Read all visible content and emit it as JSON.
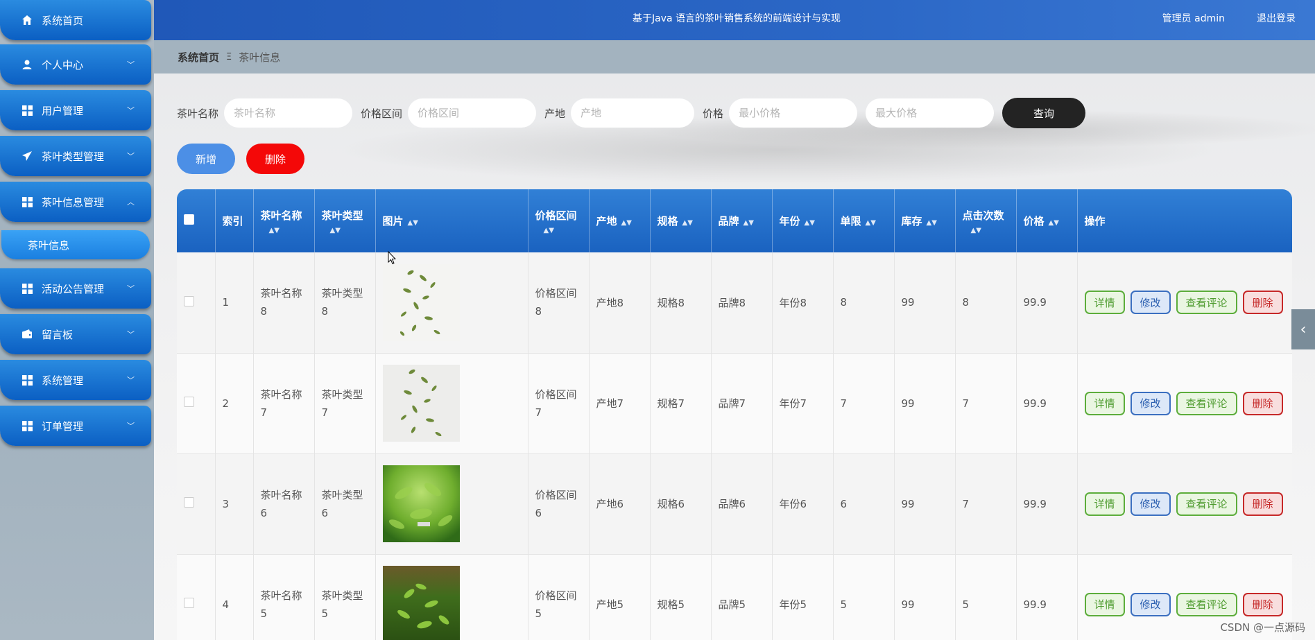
{
  "header": {
    "title": "基于Java 语言的茶叶销售系统的前端设计与实现",
    "user_label": "管理员 admin",
    "logout": "退出登录"
  },
  "sidebar": {
    "items": [
      {
        "label": "系统首页",
        "icon": "home-icon",
        "has_chevron": false
      },
      {
        "label": "个人中心",
        "icon": "person-icon",
        "has_chevron": true
      },
      {
        "label": "用户管理",
        "icon": "grid-icon",
        "has_chevron": true
      },
      {
        "label": "茶叶类型管理",
        "icon": "send-icon",
        "has_chevron": true
      },
      {
        "label": "茶叶信息管理",
        "icon": "grid-icon",
        "has_chevron": true,
        "expanded": true
      },
      {
        "label": "活动公告管理",
        "icon": "grid-icon",
        "has_chevron": true
      },
      {
        "label": "留言板",
        "icon": "wallet-icon",
        "has_chevron": true
      },
      {
        "label": "系统管理",
        "icon": "grid-icon",
        "has_chevron": true
      },
      {
        "label": "订单管理",
        "icon": "grid-icon",
        "has_chevron": true
      }
    ],
    "sub_item": "茶叶信息"
  },
  "breadcrumb": {
    "home": "系统首页",
    "separator": "Ξ",
    "current": "茶叶信息"
  },
  "search": {
    "name_label": "茶叶名称",
    "name_placeholder": "茶叶名称",
    "range_label": "价格区间",
    "range_placeholder": "价格区间",
    "origin_label": "产地",
    "origin_placeholder": "产地",
    "price_label": "价格",
    "min_placeholder": "最小价格",
    "max_placeholder": "最大价格",
    "query_button": "查询"
  },
  "actions": {
    "add": "新增",
    "delete": "删除"
  },
  "table": {
    "columns": [
      "索引",
      "茶叶名称",
      "茶叶类型",
      "图片",
      "价格区间",
      "产地",
      "规格",
      "品牌",
      "年份",
      "单限",
      "库存",
      "点击次数",
      "价格",
      "操作"
    ],
    "rows": [
      {
        "index": "1",
        "name": "茶叶名称8",
        "type": "茶叶类型8",
        "image": "tea-leaves-falling",
        "range": "价格区间8",
        "origin": "产地8",
        "spec": "规格8",
        "brand": "品牌8",
        "year": "年份8",
        "limit": "8",
        "stock": "99",
        "clicks": "8",
        "price": "99.9"
      },
      {
        "index": "2",
        "name": "茶叶名称7",
        "type": "茶叶类型7",
        "image": "tea-leaves-falling",
        "range": "价格区间7",
        "origin": "产地7",
        "spec": "规格7",
        "brand": "品牌7",
        "year": "年份7",
        "limit": "7",
        "stock": "99",
        "clicks": "7",
        "price": "99.9"
      },
      {
        "index": "3",
        "name": "茶叶名称6",
        "type": "茶叶类型6",
        "image": "green-tea-plant",
        "range": "价格区间6",
        "origin": "产地6",
        "spec": "规格6",
        "brand": "品牌6",
        "year": "年份6",
        "limit": "6",
        "stock": "99",
        "clicks": "7",
        "price": "99.9"
      },
      {
        "index": "4",
        "name": "茶叶名称5",
        "type": "茶叶类型5",
        "image": "tea-bush",
        "range": "价格区间5",
        "origin": "产地5",
        "spec": "规格5",
        "brand": "品牌5",
        "year": "年份5",
        "limit": "5",
        "stock": "99",
        "clicks": "5",
        "price": "99.9"
      }
    ],
    "row_actions": {
      "detail": "详情",
      "edit": "修改",
      "comments": "查看评论",
      "remove": "删除"
    }
  },
  "watermark": "CSDN @一点源码",
  "colors": {
    "sidebar_item": "#0b5fc3",
    "header": "#2b67c6",
    "table_header": "#1a62c0",
    "query_button": "#232323",
    "add_button": "#4c8fe6",
    "delete_button": "#f40808"
  }
}
